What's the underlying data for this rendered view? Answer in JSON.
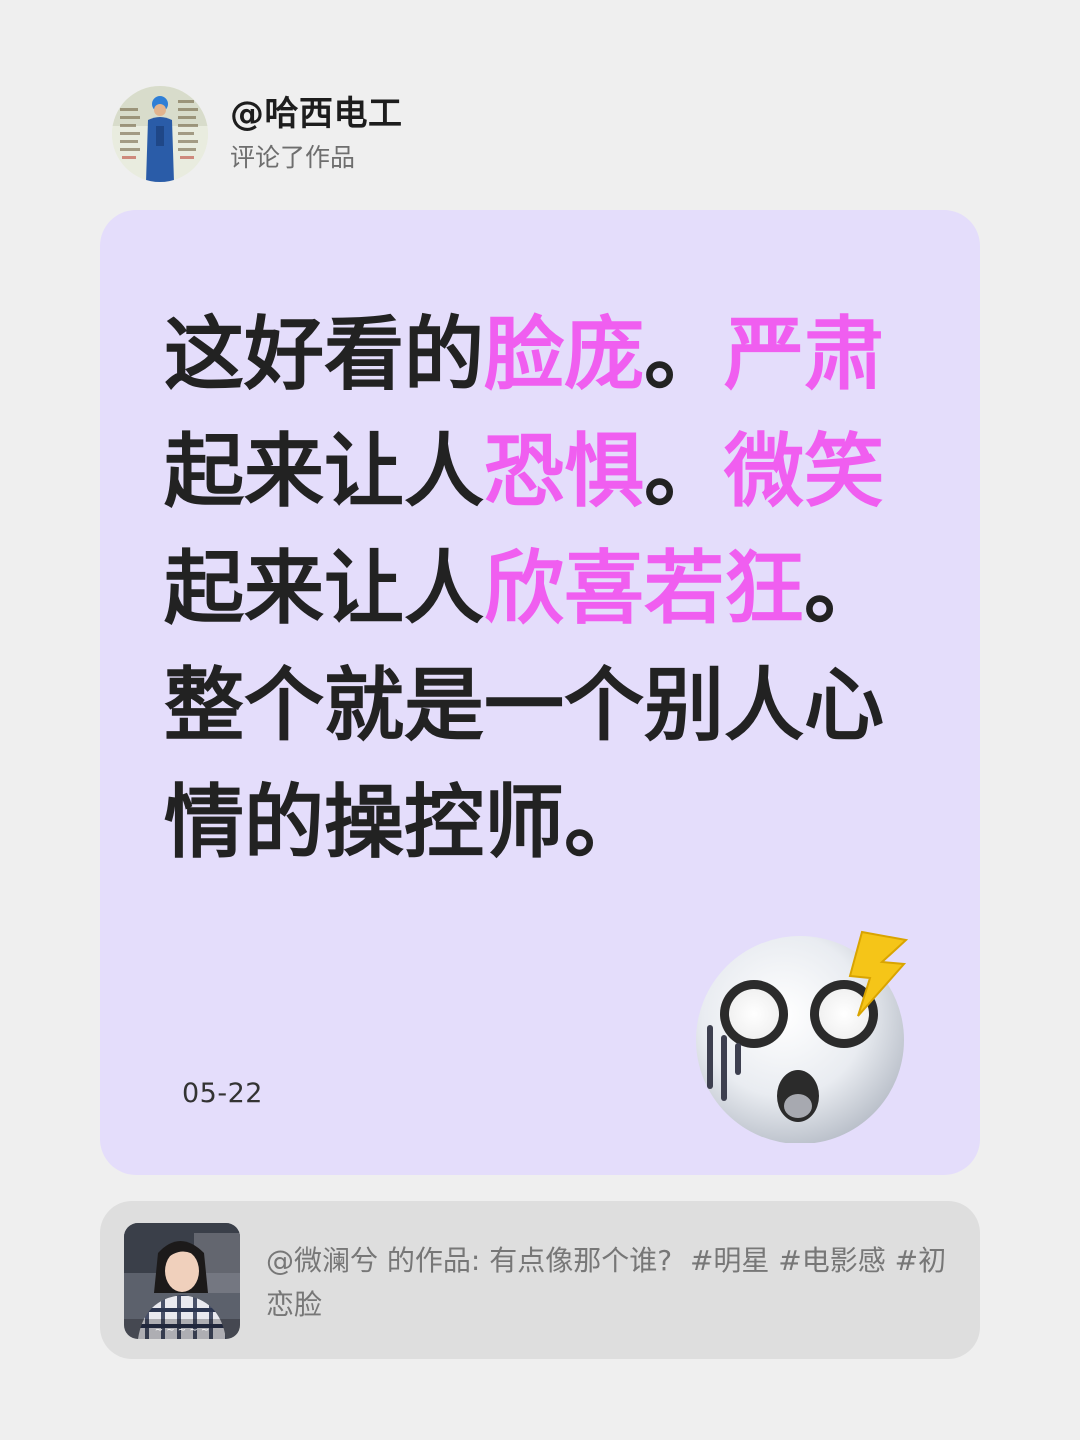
{
  "header": {
    "username": "@哈西电工",
    "action": "评论了作品",
    "avatar_icon": "avatar-worker-photo"
  },
  "comment": {
    "segments": [
      {
        "text": "这好看的",
        "highlight": false
      },
      {
        "text": "脸庞",
        "highlight": true
      },
      {
        "text": "。",
        "highlight": false
      },
      {
        "text": "严肃",
        "highlight": true
      },
      {
        "text": "起来让人",
        "highlight": false
      },
      {
        "text": "恐惧",
        "highlight": true
      },
      {
        "text": "。",
        "highlight": false
      },
      {
        "text": "微笑",
        "highlight": true
      },
      {
        "text": "起来让人",
        "highlight": false
      },
      {
        "text": "欣喜若狂",
        "highlight": true
      },
      {
        "text": "。整个就是一个别人心情的操控师。",
        "highlight": false
      }
    ],
    "date": "05-22",
    "emoji_icon": "shocked-face-emoji-icon",
    "highlight_color": "#f05ef0",
    "card_color": "#e4ddfb"
  },
  "source": {
    "author": "@微澜兮",
    "prefix": " 的作品: ",
    "title": "有点像那个谁?",
    "tags": "  #明星 #电影感 #初恋脸",
    "thumb_icon": "video-thumbnail-girl-plaid-shirt",
    "card_color": "#dedede"
  }
}
